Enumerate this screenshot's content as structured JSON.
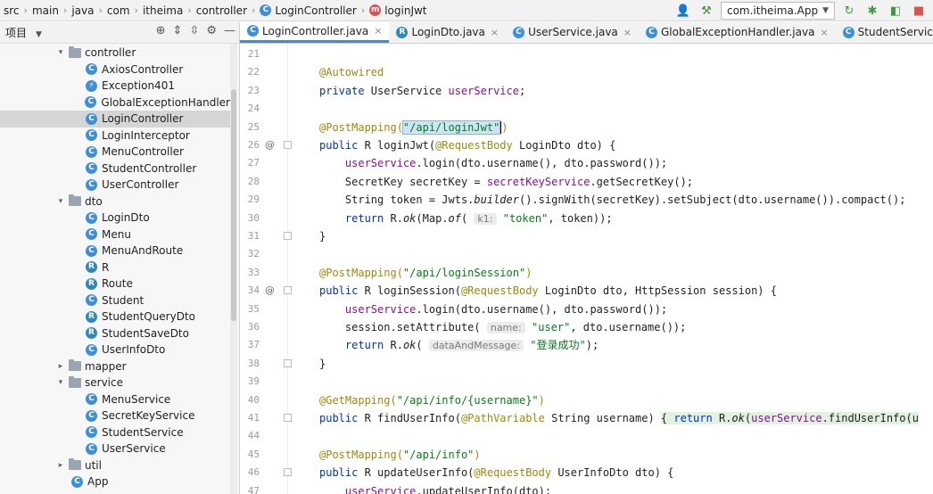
{
  "breadcrumb": [
    "src",
    "main",
    "java",
    "com",
    "itheima",
    "controller",
    "LoginController",
    "loginJwt"
  ],
  "toolbar": {
    "run_config": "com.itheima.App"
  },
  "project_panel": {
    "title": "项目",
    "tree": [
      {
        "label": "controller",
        "type": "folder",
        "expanded": true
      },
      {
        "label": "AxiosController",
        "type": "class"
      },
      {
        "label": "Exception401",
        "type": "class"
      },
      {
        "label": "GlobalExceptionHandler",
        "type": "class"
      },
      {
        "label": "LoginController",
        "type": "class",
        "selected": true
      },
      {
        "label": "LoginInterceptor",
        "type": "class"
      },
      {
        "label": "MenuController",
        "type": "class"
      },
      {
        "label": "StudentController",
        "type": "class"
      },
      {
        "label": "UserController",
        "type": "class"
      },
      {
        "label": "dto",
        "type": "folder",
        "expanded": true
      },
      {
        "label": "LoginDto",
        "type": "class"
      },
      {
        "label": "Menu",
        "type": "class"
      },
      {
        "label": "MenuAndRoute",
        "type": "class"
      },
      {
        "label": "R",
        "type": "record"
      },
      {
        "label": "Route",
        "type": "record"
      },
      {
        "label": "Student",
        "type": "class"
      },
      {
        "label": "StudentQueryDto",
        "type": "record"
      },
      {
        "label": "StudentSaveDto",
        "type": "record"
      },
      {
        "label": "UserInfoDto",
        "type": "class"
      },
      {
        "label": "mapper",
        "type": "folder",
        "expanded": false
      },
      {
        "label": "service",
        "type": "folder",
        "expanded": true
      },
      {
        "label": "MenuService",
        "type": "class"
      },
      {
        "label": "SecretKeyService",
        "type": "class"
      },
      {
        "label": "StudentService",
        "type": "class"
      },
      {
        "label": "UserService",
        "type": "class"
      },
      {
        "label": "util",
        "type": "folder",
        "expanded": false
      },
      {
        "label": "App",
        "type": "class"
      }
    ]
  },
  "tabs": [
    {
      "label": "LoginController.java",
      "active": true
    },
    {
      "label": "LoginDto.java"
    },
    {
      "label": "UserService.java"
    },
    {
      "label": "GlobalExceptionHandler.java"
    },
    {
      "label": "StudentService.java"
    }
  ],
  "editor": {
    "line_numbers": [
      "21",
      "22",
      "23",
      "24",
      "25",
      "26",
      "27",
      "28",
      "29",
      "30",
      "31",
      "32",
      "33",
      "34",
      "35",
      "36",
      "37",
      "38",
      "39",
      "40",
      "41",
      "44",
      "45",
      "46",
      "47"
    ],
    "strings": {
      "s22": "@Autowired",
      "s23a": "private ",
      "s23b": "UserService ",
      "s23c": "userService",
      "s23d": ";",
      "s25a": "@PostMapping(",
      "s25b": "\"/api/loginJwt\"",
      "s25c": ")",
      "s26a": "public ",
      "s26b": "R loginJwt(",
      "s26c": "@RequestBody",
      "s26d": " LoginDto dto) {",
      "s27a": "    ",
      "s27b": "userService",
      "s27c": ".login(dto.username(), dto.password());",
      "s28a": "    SecretKey secretKey = ",
      "s28b": "secretKeyService",
      "s28c": ".getSecretKey();",
      "s29a": "    String token = Jwts.",
      "s29b": "builder",
      "s29c": "().signWith(secretKey).setSubject(dto.username()).compact();",
      "s30a": "    ",
      "s30b": "return ",
      "s30c": "R.",
      "s30d": "ok",
      "s30e": "(Map.",
      "s30f": "of",
      "s30g": "( ",
      "s30h": "k1:",
      "s30i": " \"token\"",
      "s30j": ", token));",
      "s31": "}",
      "s33a": "@PostMapping(",
      "s33b": "\"/api/loginSession\"",
      "s33c": ")",
      "s34a": "public ",
      "s34b": "R loginSession(",
      "s34c": "@RequestBody",
      "s34d": " LoginDto dto, HttpSession session) {",
      "s35a": "    ",
      "s35b": "userService",
      "s35c": ".login(dto.username(), dto.password());",
      "s36a": "    session.setAttribute( ",
      "s36b": "name:",
      "s36c": " \"user\"",
      "s36d": ", dto.username());",
      "s37a": "    ",
      "s37b": "return ",
      "s37c": "R.",
      "s37d": "ok",
      "s37e": "( ",
      "s37f": "dataAndMessage:",
      "s37g": " \"登录成功\"",
      "s37h": ");",
      "s38": "}",
      "s40a": "@GetMapping(",
      "s40b": "\"/api/info/{username}\"",
      "s40c": ")",
      "s41a": "public ",
      "s41b": "R findUserInfo(",
      "s41c": "@PathVariable",
      "s41d": " String username) ",
      "s41e": "{ ",
      "s41f": "return ",
      "s41g": "R.",
      "s41h": "ok",
      "s41i": "(",
      "s41j": "userService",
      "s41k": ".findUserInfo(u",
      "s45a": "@PostMapping(",
      "s45b": "\"/api/info\"",
      "s45c": ")",
      "s46a": "public ",
      "s46b": "R updateUserInfo(",
      "s46c": "@RequestBody",
      "s46d": " UserInfoDto dto) {",
      "s47a": "    ",
      "s47b": "userService",
      "s47c": ".updateUserInfo(dto);"
    }
  },
  "colors": {
    "accent": "#4a88c7",
    "keyword": "#0033b3",
    "string": "#067d17",
    "annotation": "#9e880d",
    "field": "#871094"
  }
}
